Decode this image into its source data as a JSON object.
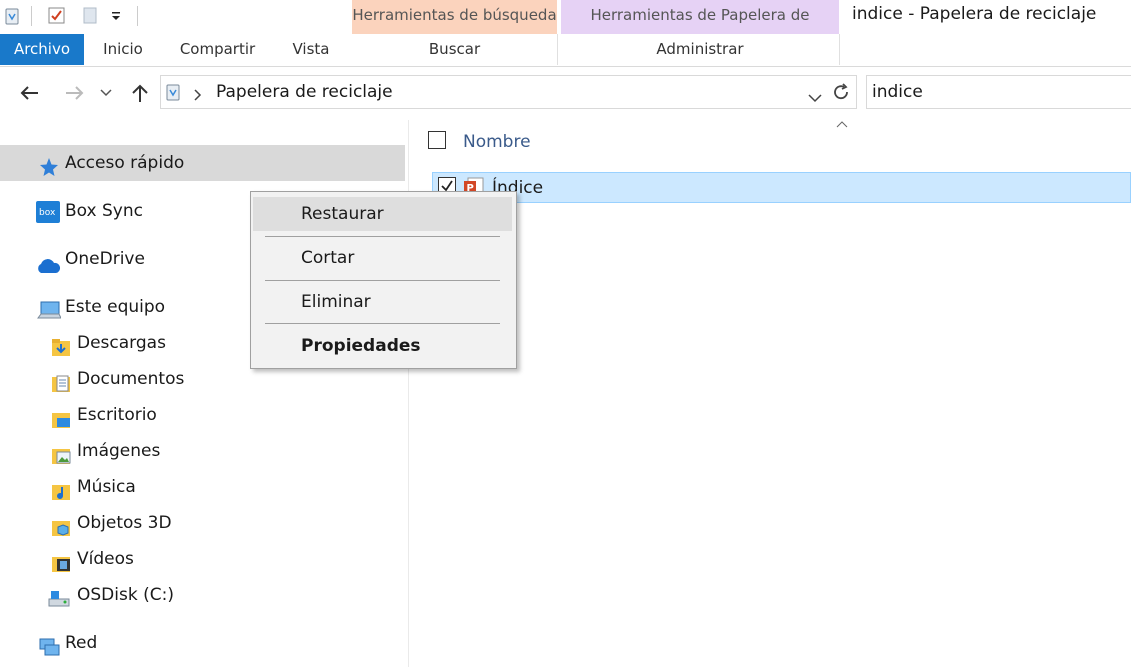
{
  "titlebar": {
    "context_search": "Herramientas de búsqueda",
    "context_recycle": "Herramientas de Papelera de reciclaje",
    "window_title": "indice - Papelera de reciclaje"
  },
  "ribbon": {
    "tabs": [
      "Archivo",
      "Inicio",
      "Compartir",
      "Vista"
    ],
    "context_tabs": [
      "Buscar",
      "Administrar"
    ]
  },
  "address": {
    "path": "Papelera de reciclaje",
    "search_value": "indice"
  },
  "nav": {
    "quick_access": "Acceso rápido",
    "box_sync": "Box Sync",
    "onedrive": "OneDrive",
    "this_pc": "Este equipo",
    "folders": [
      "Descargas",
      "Documentos",
      "Escritorio",
      "Imágenes",
      "Música",
      "Objetos 3D",
      "Vídeos",
      "OSDisk (C:)"
    ],
    "network": "Red"
  },
  "content": {
    "column_name": "Nombre",
    "items": [
      {
        "name": "Índice"
      }
    ]
  },
  "context_menu": {
    "items": [
      "Restaurar",
      "Cortar",
      "Eliminar",
      "Propiedades"
    ]
  },
  "colors": {
    "accent": "#1979ca",
    "selection": "#cce8ff",
    "context_search_bg": "#fbd3bd",
    "context_recycle_bg": "#e6d2f5"
  }
}
